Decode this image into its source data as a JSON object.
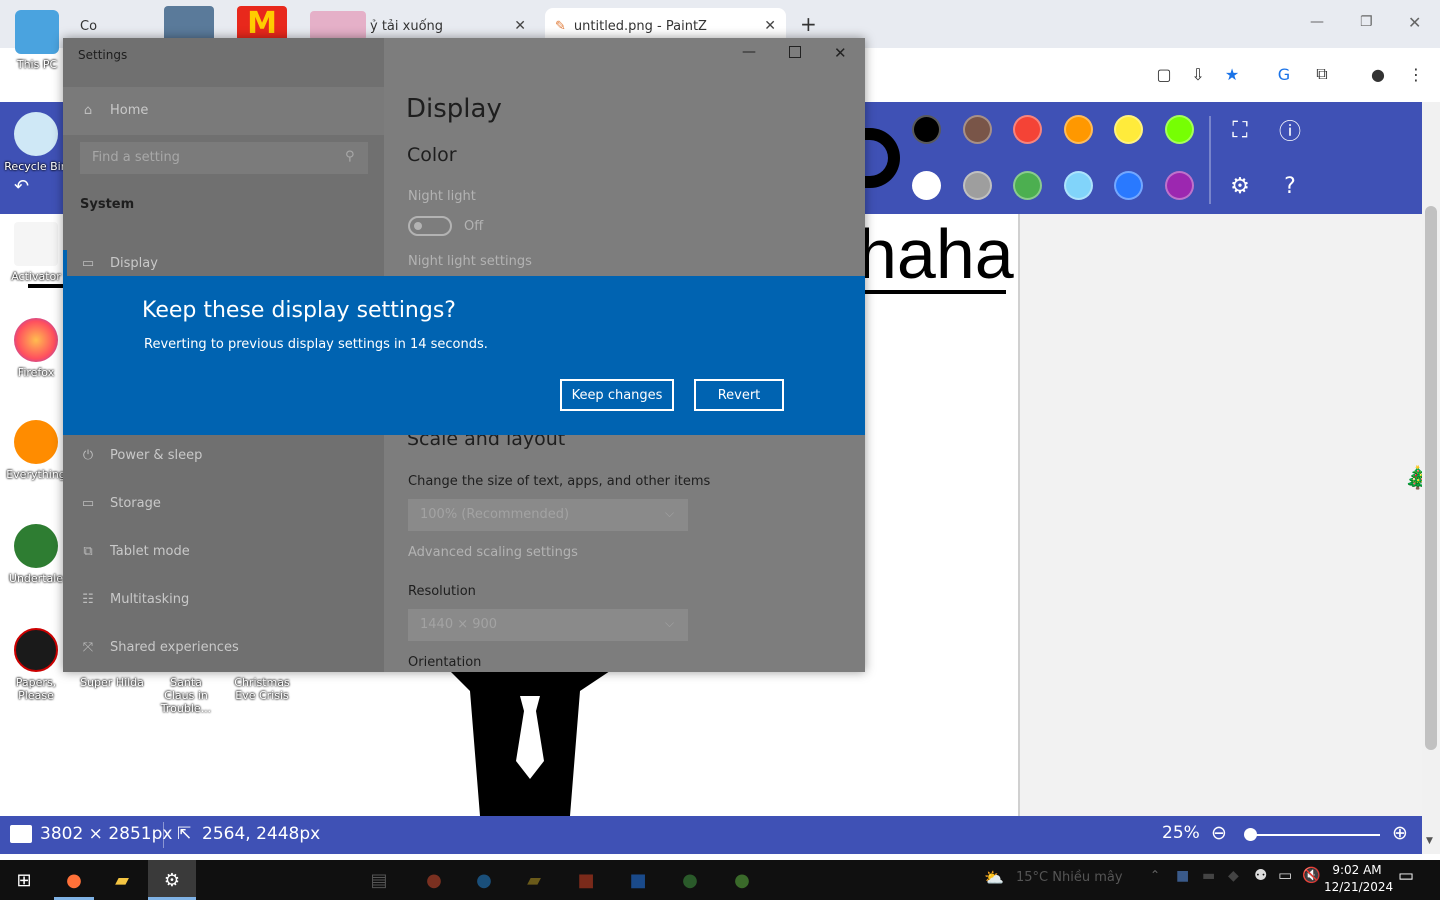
{
  "browser": {
    "tabs": [
      {
        "label": "Co",
        "active": false
      },
      {
        "label": "ỷ tải xuống",
        "active": false
      },
      {
        "label": "untitled.png - PaintZ",
        "active": true
      }
    ],
    "new_tab": "+",
    "window_controls": {
      "minimize": "—",
      "restore": "❐",
      "close": "✕"
    }
  },
  "paintz": {
    "colors_row1": [
      "#000000",
      "#795548",
      "#f44336",
      "#ff9800",
      "#ffeb3b",
      "#76ff03"
    ],
    "colors_row2": [
      "#ffffff",
      "#9e9e9e",
      "#4caf50",
      "#81d4fa",
      "#2979ff",
      "#9c27b0"
    ],
    "canvas_text": "haha",
    "status": {
      "image_size": "3802 × 2851px",
      "cursor_pos": "2564, 2448px",
      "zoom": "25%"
    }
  },
  "desktop_icons": [
    {
      "label": "This PC"
    },
    {
      "label": "Recycle Bin"
    },
    {
      "label": "Activator"
    },
    {
      "label": "Firefox"
    },
    {
      "label": "Everything"
    },
    {
      "label": "Undertale"
    },
    {
      "label": "Papers, Please"
    },
    {
      "label": "Super Hilda"
    },
    {
      "label": "Santa Claus in Trouble..."
    },
    {
      "label": "Christmas Eve Crisis"
    }
  ],
  "settings": {
    "title": "Settings",
    "nav": {
      "home": "Home",
      "search_placeholder": "Find a setting",
      "section": "System",
      "items": [
        "Display",
        "Power & sleep",
        "Storage",
        "Tablet mode",
        "Multitasking",
        "Shared experiences"
      ]
    },
    "content": {
      "heading": "Display",
      "color_heading": "Color",
      "night_light_label": "Night light",
      "night_light_state": "Off",
      "night_light_settings": "Night light settings",
      "scale_heading": "Scale and layout",
      "scale_label": "Change the size of text, apps, and other items",
      "scale_value": "100% (Recommended)",
      "advanced_scaling": "Advanced scaling settings",
      "resolution_label": "Resolution",
      "resolution_value": "1440 × 900",
      "orientation_label": "Orientation"
    }
  },
  "dialog": {
    "title": "Keep these display settings?",
    "message": "Reverting to previous display settings in 14 seconds.",
    "keep_button": "Keep changes",
    "revert_button": "Revert"
  },
  "taskbar": {
    "weather": "15°C Nhiều mây",
    "time": "9:02 AM",
    "date": "12/21/2024"
  }
}
